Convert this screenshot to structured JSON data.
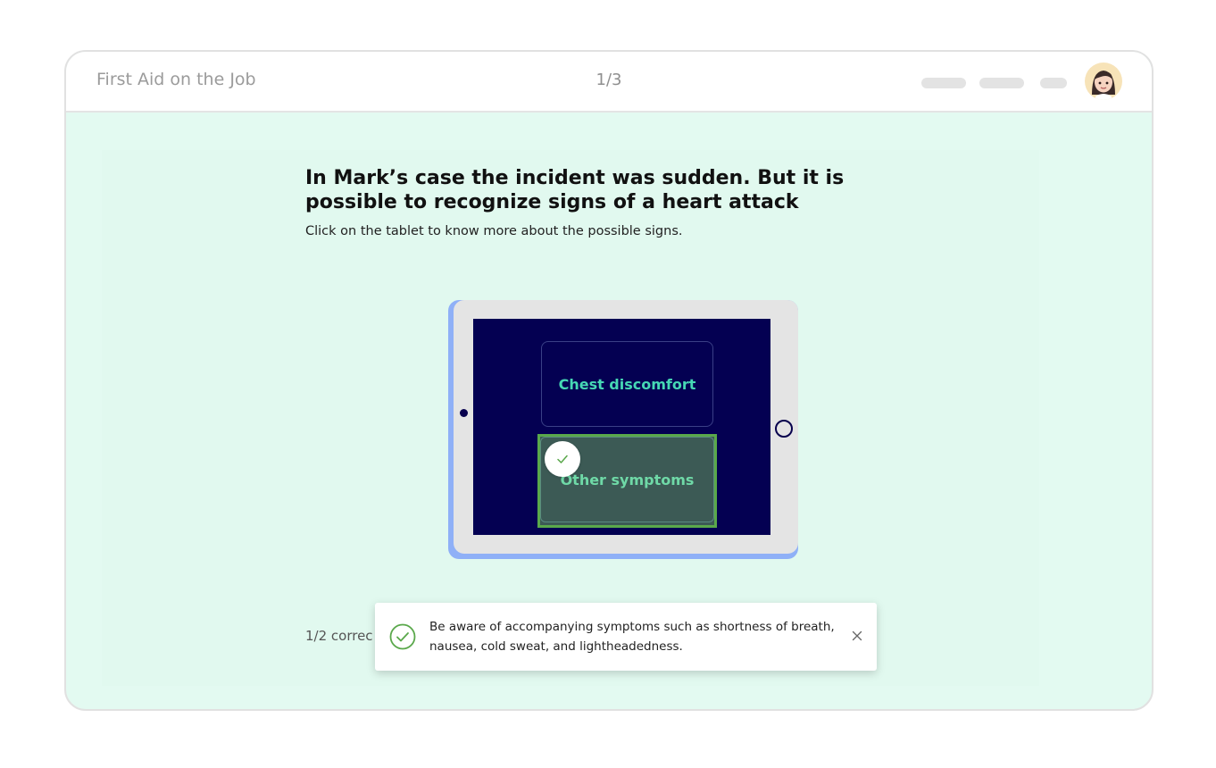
{
  "header": {
    "course_title": "First Aid on the Job",
    "page_indicator": "1/3"
  },
  "question": {
    "heading": "In Mark’s case the incident was sudden. But it is possible to recognize signs of a heart attack",
    "instruction": "Click on the tablet to know more about the possible signs."
  },
  "tablet": {
    "cards": [
      {
        "label": "Chest discomfort",
        "selected": false
      },
      {
        "label": "Other symptoms",
        "selected": true
      }
    ]
  },
  "progress": {
    "text": "1/2 correc"
  },
  "toast": {
    "message": "Be aware of accompanying symptoms such as shortness of breath, nausea, cold sweat, and lightheadedness.",
    "icons": {
      "status": "check-circle-icon",
      "close": "close-icon"
    }
  },
  "colors": {
    "background": "#e3faf1",
    "screen": "#040052",
    "card_text": "#46d8b4",
    "success": "#5aa84b",
    "tablet_accent": "#8fb0f7"
  }
}
